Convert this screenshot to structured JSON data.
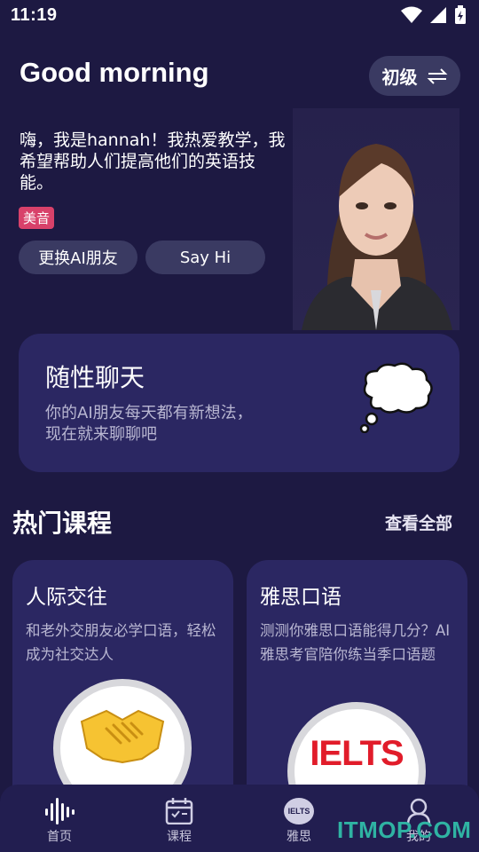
{
  "status": {
    "time": "11:19"
  },
  "header": {
    "greeting": "Good morning",
    "level_label": "初级"
  },
  "tutor": {
    "intro": "嗨，我是hannah！我热爱教学，我希望帮助人们提高他们的英语技能。",
    "accent_badge": "美音",
    "switch_button": "更换AI朋友",
    "say_hi_button": "Say Hi"
  },
  "chat_card": {
    "title": "随性聊天",
    "subtitle": "你的AI朋友每天都有新想法，现在就来聊聊吧"
  },
  "popular": {
    "title": "热门课程",
    "view_all": "查看全部",
    "courses": [
      {
        "title": "人际交往",
        "desc": "和老外交朋友必学口语，轻松成为社交达人",
        "icon": "handshake-icon"
      },
      {
        "title": "雅思口语",
        "desc": "测测你雅思口语能得几分？AI雅思考官陪你练当季口语题",
        "icon": "ielts-logo",
        "logo_text": "IELTS"
      }
    ]
  },
  "nav": {
    "items": [
      {
        "label": "首页",
        "icon": "soundwave-icon"
      },
      {
        "label": "课程",
        "icon": "calendar-check-icon"
      },
      {
        "label": "雅思",
        "icon": "ielts-icon",
        "icon_text": "IELTS"
      },
      {
        "label": "我的",
        "icon": "profile-icon"
      }
    ]
  },
  "watermark": "ITMOP.COM",
  "colors": {
    "background": "#1d1942",
    "card": "#2b2762",
    "pill": "#3a3a62",
    "badge": "#d8416a",
    "ielts_red": "#e11c2a"
  }
}
